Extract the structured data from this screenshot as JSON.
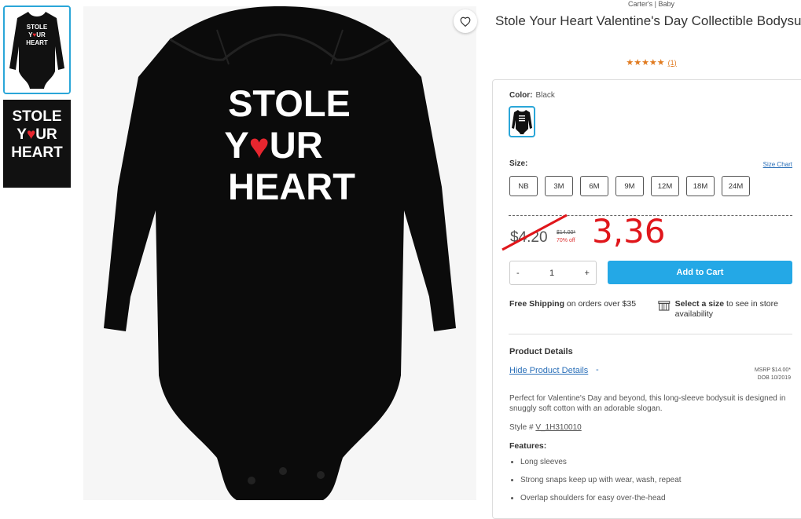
{
  "product": {
    "breadcrumb": "Carter's | Baby",
    "title": "Stole Your Heart Valentine's Day Collectible Bodysuit",
    "rating_stars": "★★★★★",
    "rating_count": "(1)",
    "graphic_lines": [
      "STOLE",
      "Y",
      "UR",
      "HEART"
    ]
  },
  "options": {
    "color_label": "Color:",
    "color_value": "Black",
    "size_label": "Size:",
    "size_chart_link": "Size Chart",
    "sizes": [
      "NB",
      "3M",
      "6M",
      "9M",
      "12M",
      "18M",
      "24M"
    ]
  },
  "pricing": {
    "current_price": "$4.20",
    "original_price": "$14.00*",
    "discount": "70% off",
    "annotation": "3,36"
  },
  "cart": {
    "qty_minus": "-",
    "qty_value": "1",
    "qty_plus": "+",
    "add_label": "Add to Cart"
  },
  "shipping": {
    "free_bold": "Free Shipping",
    "free_rest": " on orders over $35",
    "store_bold": "Select a size",
    "store_rest": " to see in store availability"
  },
  "details": {
    "heading": "Product Details",
    "hide_link": "Hide Product Details",
    "hide_dash": "-",
    "msrp": "MSRP $14.00*",
    "dob": "DOB 10/2019",
    "description": "Perfect for Valentine's Day and beyond, this long-sleeve bodysuit is designed in snuggly soft cotton with an adorable slogan.",
    "style_prefix": "Style #",
    "style_number": "V_1H310010",
    "features_heading": "Features:",
    "features": [
      "Long sleeves",
      "Strong snaps keep up with wear, wash, repeat",
      "Overlap shoulders for easy over-the-head"
    ]
  },
  "colors": {
    "accent": "#24a8e6",
    "link": "#2a6fb8",
    "annotation": "#e0161b",
    "heart": "#e8262f",
    "stars": "#e07a1f"
  }
}
